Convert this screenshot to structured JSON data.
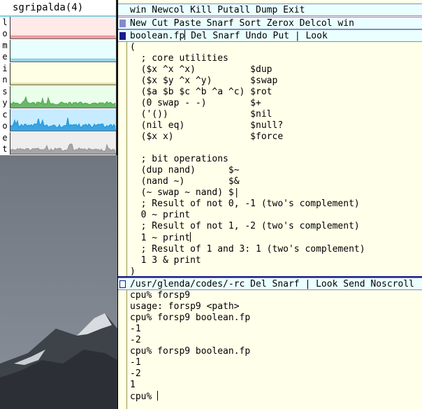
{
  "stats": {
    "title": "sgripalda(4)",
    "meters": [
      {
        "label": "l\no",
        "color": "#f09090",
        "bg": "#ffe9e9",
        "level": 0.05
      },
      {
        "label": "m\ne",
        "color": "#88ccdd",
        "bg": "#e9ffff",
        "level": 0.05
      },
      {
        "label": "i\nn",
        "color": "#dddd88",
        "bg": "#ffffe6",
        "level": 0.0
      },
      {
        "label": "s\ny",
        "color": "#55aa55",
        "bg": "#e9ffe9",
        "level": 0.15
      },
      {
        "label": "c\no",
        "color": "#2299dd",
        "bg": "#c8ecff",
        "level": 0.2
      },
      {
        "label": "e\nt",
        "color": "#999999",
        "bg": "#eeeeee",
        "level": 0.15
      }
    ]
  },
  "acme": {
    "column_tag": "win Newcol Kill Putall Dump Exit",
    "window_tag": "New Cut Paste Snarf Sort Zerox Delcol win",
    "file_tag": {
      "name": "boolean.fp",
      "commands": " Del Snarf Undo Put | Look"
    },
    "file_lines": [
      "(",
      "  ; core utilities",
      "  ($x ^x ^x)          $dup",
      "  ($x $y ^x ^y)       $swap",
      "  ($a $b $c ^b ^a ^c) $rot",
      "  (0 swap - -)        $+",
      "  ('())               $nil",
      "  (nil eq)            $null?",
      "  ($x x)              $force",
      "",
      "  ; bit operations",
      "  (dup nand)      $~",
      "  (nand ~)        $&",
      "  (~ swap ~ nand) $|",
      "  ; Result of not 0, -1 (two's complement)",
      "  0 ~ print",
      "  ; Result of not 1, -2 (two's complement)",
      "  1 ~ print",
      "  ; Result of 1 and 3: 1 (two's complement)",
      "  1 3 & print",
      ")"
    ],
    "shell_tag": "/usr/glenda/codes/-rc Del Snarf | Look Send Noscroll",
    "shell_lines": [
      "cpu% forsp9",
      "usage: forsp9 <path>",
      "cpu% forsp9 boolean.fp",
      "-1",
      "-2",
      "cpu% forsp9 boolean.fp",
      "-1",
      "-2",
      "1",
      "cpu% "
    ]
  }
}
